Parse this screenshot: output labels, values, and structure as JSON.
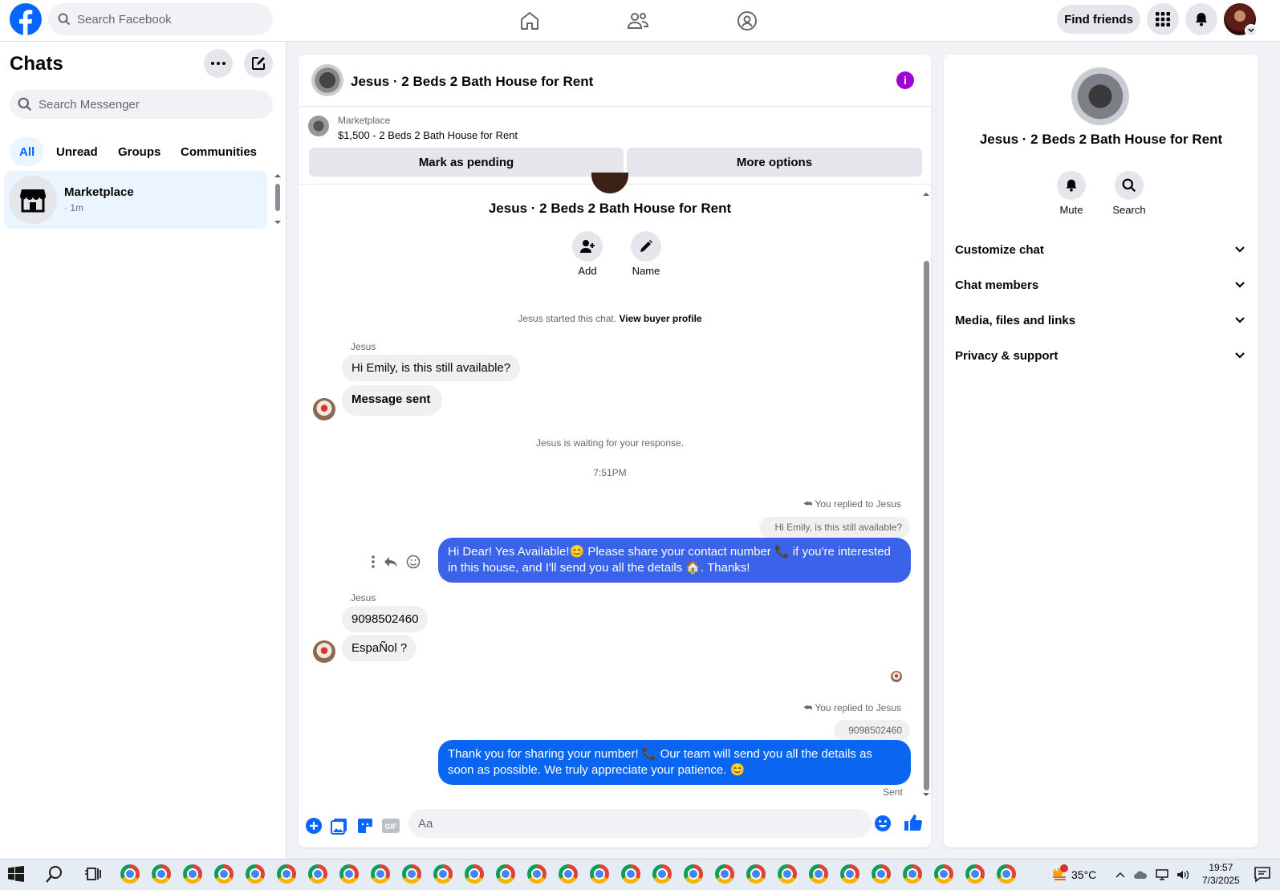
{
  "topbar": {
    "search_placeholder": "Search Facebook",
    "find_friends": "Find friends"
  },
  "chats_panel": {
    "title": "Chats",
    "search_placeholder": "Search Messenger",
    "filters": [
      "All",
      "Unread",
      "Groups",
      "Communities"
    ],
    "active_filter": "All",
    "items": [
      {
        "name": "Marketplace",
        "time": "· 1m"
      }
    ]
  },
  "chat": {
    "title": "Jesus · 2 Beds 2 Bath House for Rent",
    "marketplace_label": "Marketplace",
    "listing": "$1,500 - 2 Beds 2 Bath House for Rent",
    "mark_pending": "Mark as pending",
    "more_options": "More options",
    "intro_name": "Jesus · 2 Beds 2 Bath House for Rent",
    "intro_actions": [
      "Add",
      "Name"
    ],
    "started_text": "Jesus started this chat.",
    "view_buyer_profile": "View buyer profile",
    "sender_1": "Jesus",
    "msg_1": "Hi Emily, is this still available?",
    "msg_2": "Message sent",
    "waiting": "Jesus is waiting for your response.",
    "time_divider": "7:51PM",
    "reply_header_1": "You replied to Jesus",
    "quote_1": "Hi Emily, is this still available?",
    "out_1": "Hi Dear! Yes Available!😊 Please share your contact number 📞 if you're interested in this house, and I'll send you all the details 🏠. Thanks!",
    "sender_2": "Jesus",
    "msg_3": "9098502460",
    "msg_4": "EspaÑol ?",
    "reply_header_2": "You replied to Jesus",
    "quote_2": "9098502460",
    "out_2": "Thank you for sharing your number! 📞 Our team will send you all the details as soon as possible. We truly appreciate your patience. 😊",
    "status": "Sent",
    "composer_placeholder": "Aa"
  },
  "right_panel": {
    "name": "Jesus · 2 Beds 2 Bath House for Rent",
    "actions": [
      "Mute",
      "Search"
    ],
    "sections": [
      "Customize chat",
      "Chat members",
      "Media, files and links",
      "Privacy & support"
    ]
  },
  "taskbar": {
    "temperature": "35°C",
    "time": "19:57",
    "date": "7/3/2025",
    "weather_badge": "1"
  },
  "colors": {
    "brand": "#0866ff",
    "outgoing_bubble": "#3a63e9",
    "info_icon": "#a300d6"
  }
}
